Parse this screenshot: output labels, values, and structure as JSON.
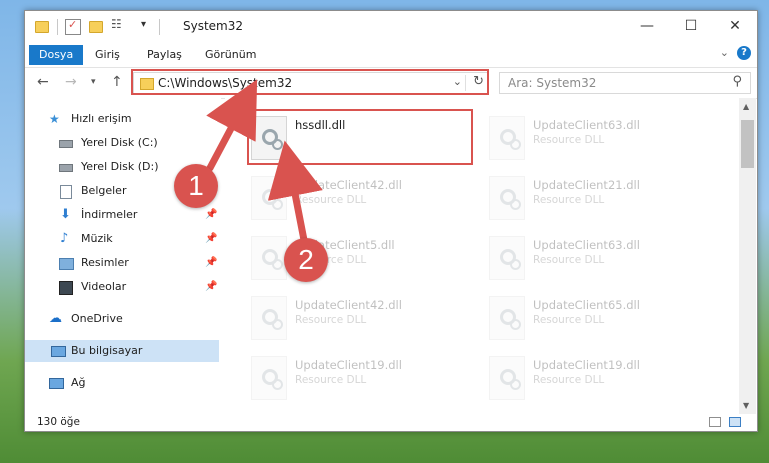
{
  "window": {
    "title": "System32",
    "controls": {
      "minimize": "—",
      "maximize": "☐",
      "close": "✕"
    }
  },
  "ribbon": {
    "tabs": [
      "Dosya",
      "Giriş",
      "Paylaş",
      "Görünüm"
    ],
    "active_tab": "Dosya",
    "help": "?"
  },
  "address_bar": {
    "path": "C:\\Windows\\System32",
    "search_placeholder": "Ara: System32"
  },
  "nav_pane": {
    "quick_access": "Hızlı erişim",
    "items": [
      {
        "label": "Yerel Disk (C:)",
        "pinned": true
      },
      {
        "label": "Yerel Disk (D:)",
        "pinned": true
      },
      {
        "label": "Belgeler",
        "pinned": true
      },
      {
        "label": "İndirmeler",
        "pinned": true
      },
      {
        "label": "Müzik",
        "pinned": true
      },
      {
        "label": "Resimler",
        "pinned": true
      },
      {
        "label": "Videolar",
        "pinned": true
      }
    ],
    "onedrive": "OneDrive",
    "this_pc": "Bu bilgisayar",
    "network": "Ağ"
  },
  "files": {
    "highlighted": {
      "name": "hssdll.dll",
      "type": ""
    },
    "grid": [
      {
        "name": "UpdateClient63.dll",
        "type": "Resource DLL"
      },
      {
        "name": "UpdateClient42.dll",
        "type": "Resource DLL"
      },
      {
        "name": "UpdateClient21.dll",
        "type": "Resource DLL"
      },
      {
        "name": "UpdateClient5.dll",
        "type": "Resource DLL"
      },
      {
        "name": "UpdateClient63.dll",
        "type": "Resource DLL"
      },
      {
        "name": "UpdateClient42.dll",
        "type": "Resource DLL"
      },
      {
        "name": "UpdateClient65.dll",
        "type": "Resource DLL"
      },
      {
        "name": "UpdateClient19.dll",
        "type": "Resource DLL"
      },
      {
        "name": "UpdateClient19.dll",
        "type": "Resource DLL"
      }
    ]
  },
  "status_bar": {
    "item_count": "130 öğe"
  },
  "annotations": {
    "step1": "1",
    "step2": "2",
    "color": "#d9534f"
  }
}
